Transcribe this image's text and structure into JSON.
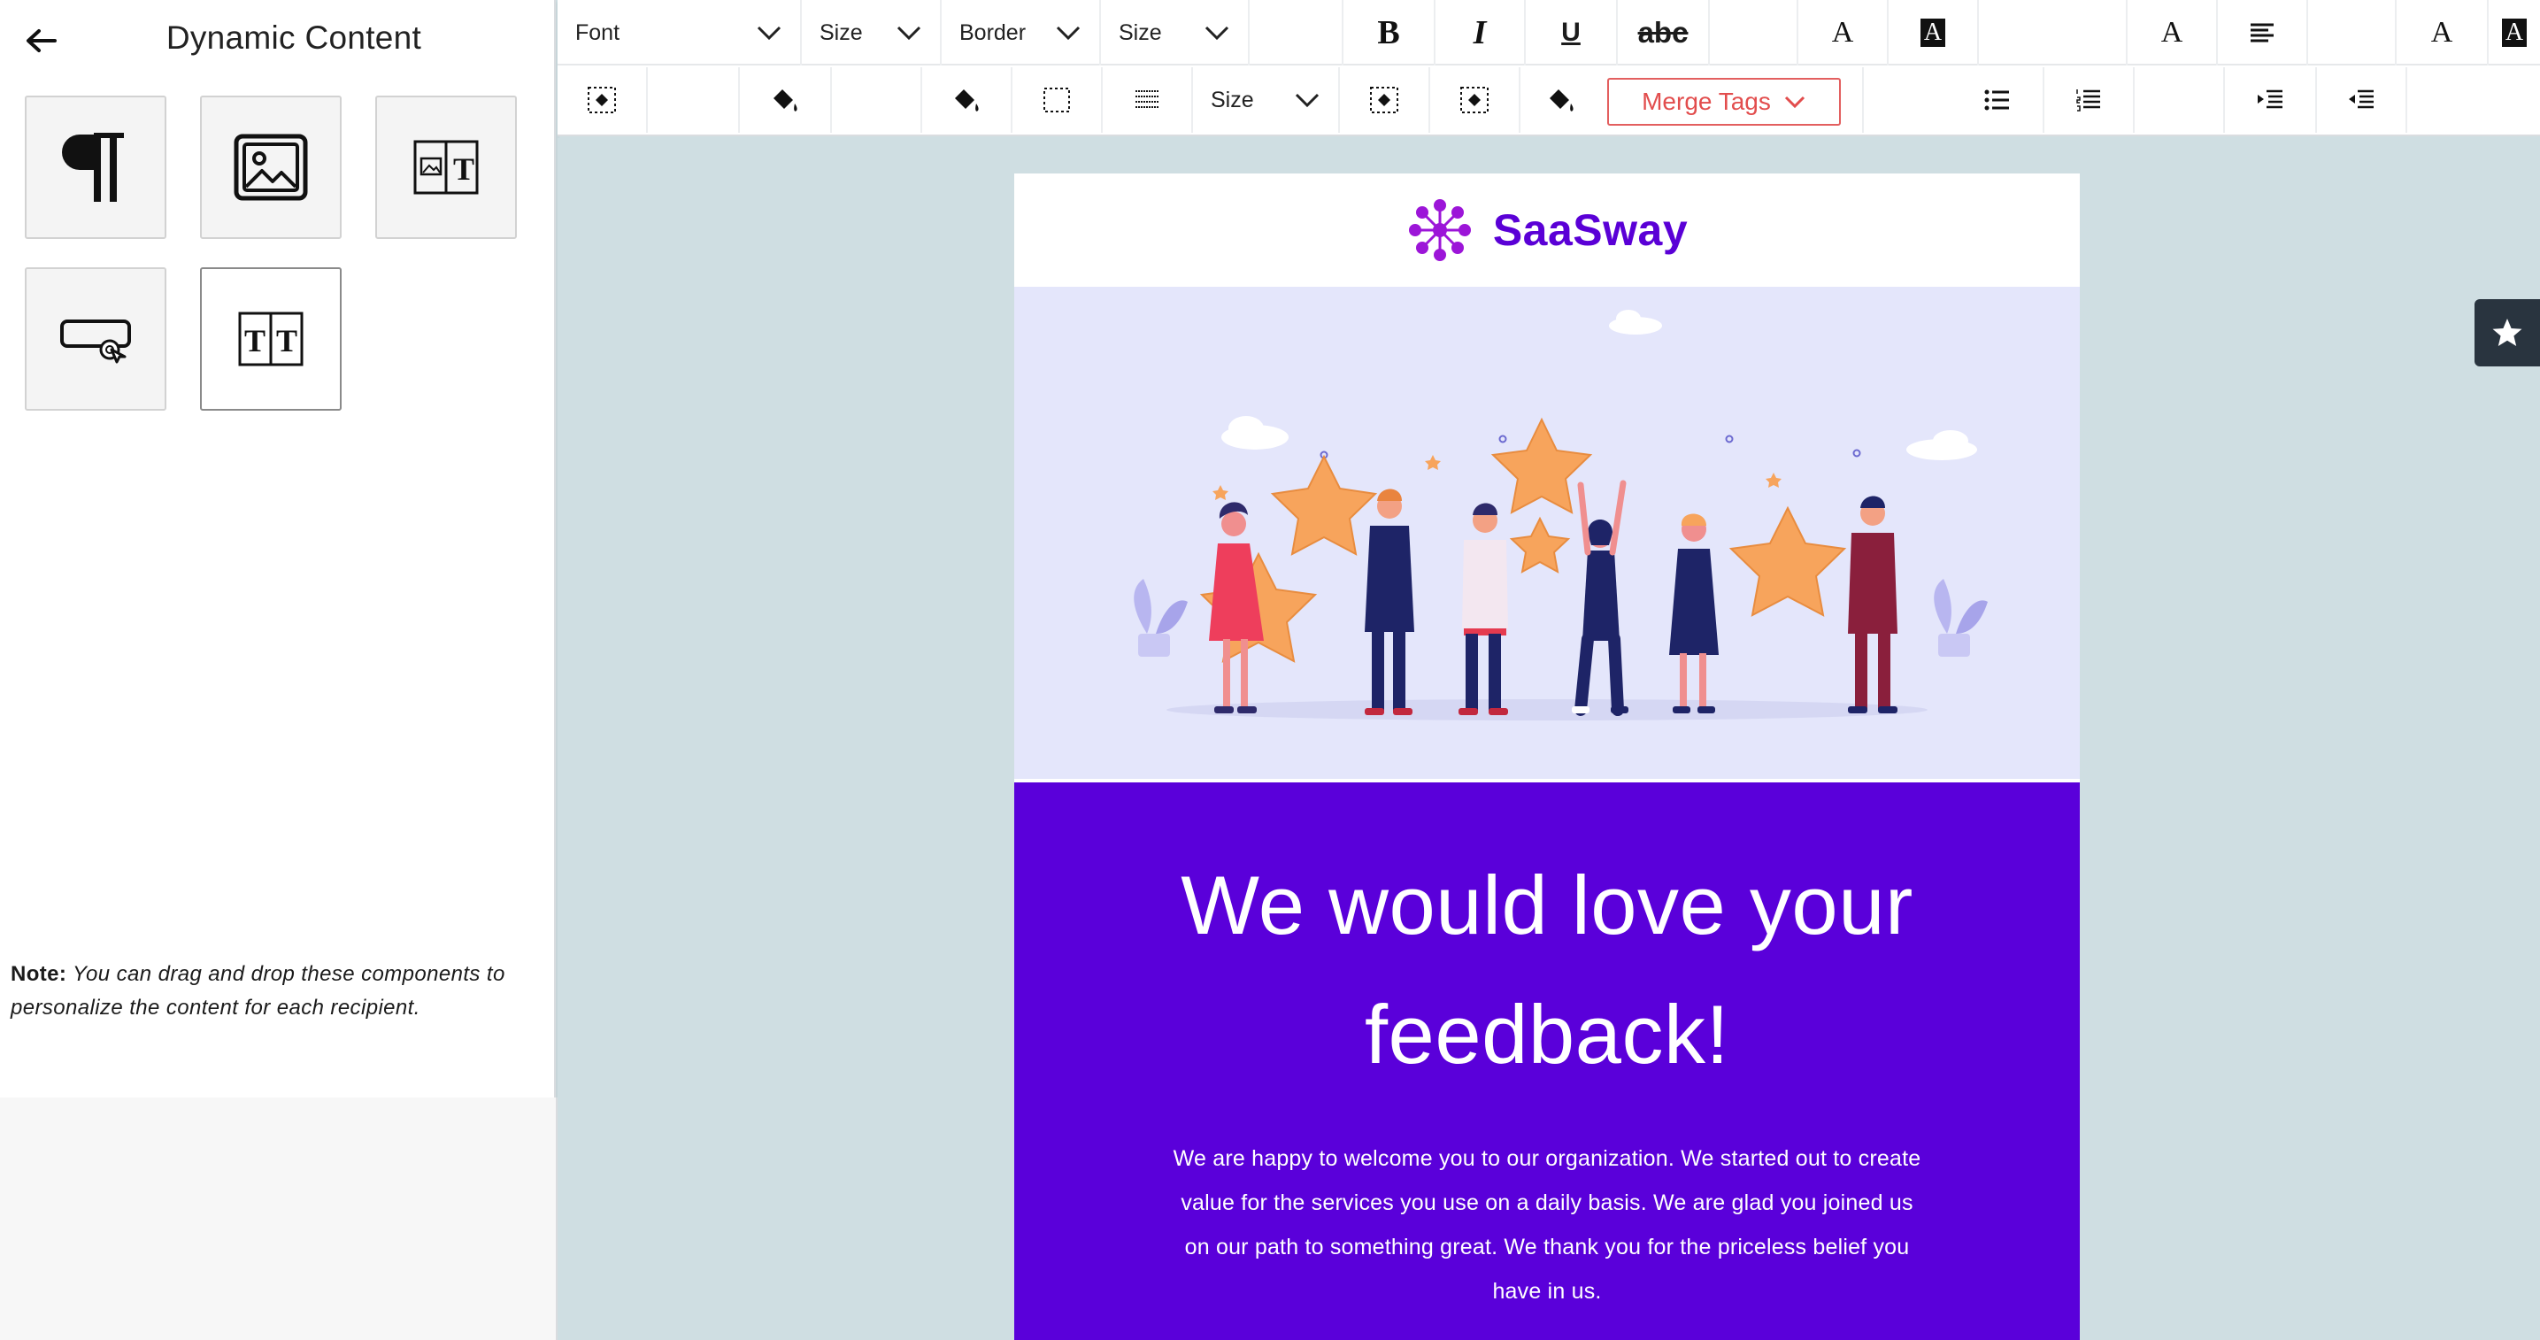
{
  "panel": {
    "title": "Dynamic Content",
    "back_icon": "arrow-left-icon",
    "tiles": [
      {
        "name": "paragraph",
        "icon": "pilcrow-icon"
      },
      {
        "name": "image",
        "icon": "image-icon"
      },
      {
        "name": "image-text",
        "icon": "image-text-icon",
        "glyph": "T"
      },
      {
        "name": "button",
        "icon": "button-cursor-icon"
      },
      {
        "name": "two-columns",
        "icon": "two-column-text-icon",
        "glyph": "T"
      }
    ],
    "note_label": "Note:",
    "note_text": " You can drag and drop these components to personalize the content for each recipient."
  },
  "toolbar": {
    "font_label": "Font",
    "size_label": "Size",
    "border_label": "Border",
    "size2_label": "Size",
    "bold": "B",
    "italic": "I",
    "underline": "U",
    "strike": "abc",
    "font_color_glyph": "A",
    "bg_color_glyph": "A",
    "size3_label": "Size",
    "merge_tags_label": "Merge Tags"
  },
  "email": {
    "brand_name": "SaaSway",
    "headline": "We would love your feedback!",
    "body": "We are happy to welcome you to our organization. We started out to create value for the services you use on a daily basis. We are glad you joined us on our path to something great. We thank you for the priceless belief you have in us."
  },
  "colors": {
    "brand_purple": "#5a00d6",
    "merge_tags_red": "#e24d4d",
    "canvas_bg": "#cfdee2",
    "hero_bg": "#e4e6fb",
    "star_orange": "#f7a45c"
  }
}
